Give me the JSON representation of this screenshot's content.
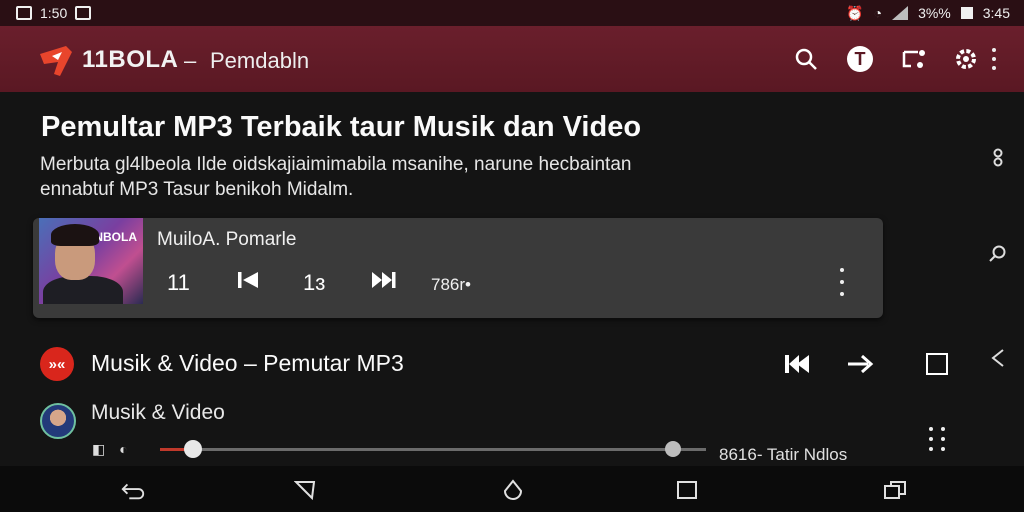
{
  "status_bar": {
    "time_left": "1:50",
    "battery_text": "3%%",
    "clock": "3:45"
  },
  "app_bar": {
    "title": "11BOLA",
    "separator": "–",
    "subtitle": "Pemdabln",
    "icons": [
      "search-icon",
      "t-badge-icon",
      "cast-icon",
      "settings-icon",
      "more-vert-icon"
    ],
    "accent": "#5a1823"
  },
  "hero": {
    "heading": "Pemultar MP3 Terbaik taur Musik dan Video",
    "description_line1": "Merbuta gl4lbeola Ilde oidskajiaimimabila msanihe, narune hecbaintan",
    "description_line2": "ennabtuf MP3 Tasur benikoh Midalm."
  },
  "player_card": {
    "album_label": "NBOLA",
    "track": "MuiloA. Pomarle",
    "counter": "11",
    "position": "1ɜ",
    "time": "786r•"
  },
  "row": {
    "title": "Musik & Video – Pemutar MP3",
    "icon_text": "»«",
    "accent": "#d9261c"
  },
  "sub": {
    "title": "Musik & Video",
    "progress_label": "8616- Tatir Ndlos",
    "progress": 0.06,
    "buffer": 0.94
  },
  "side_icons": [
    "link-icon",
    "search-icon",
    "chevron-left-icon"
  ],
  "nav_bar": [
    "back-icon",
    "home-outline-icon",
    "recents-icon"
  ]
}
